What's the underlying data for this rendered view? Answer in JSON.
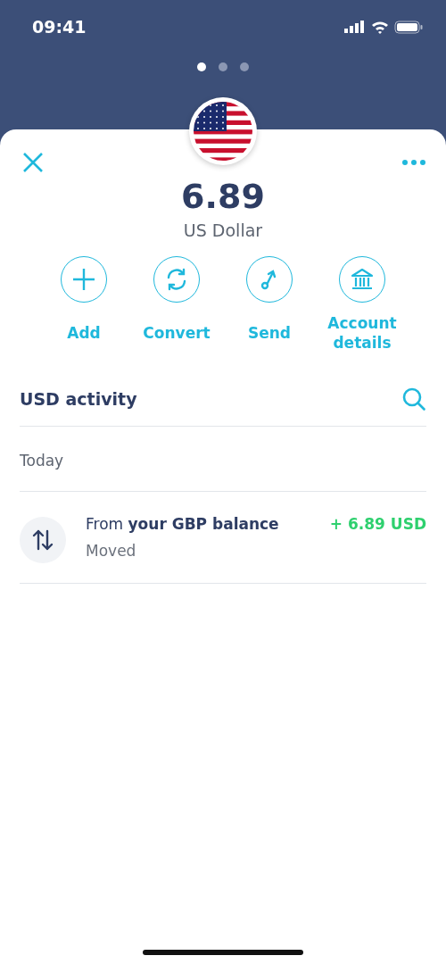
{
  "status_bar": {
    "time": "09:41"
  },
  "pager": [
    {
      "selected": true
    },
    {
      "selected": false
    },
    {
      "selected": false
    }
  ],
  "balance": {
    "amount": "6.89",
    "currency": "US Dollar"
  },
  "actions": [
    {
      "kind": "add",
      "label": "Add"
    },
    {
      "kind": "convert",
      "label": "Convert"
    },
    {
      "kind": "send",
      "label": "Send"
    },
    {
      "kind": "bank",
      "label": "Account details"
    }
  ],
  "activity": {
    "title": "USD activity",
    "groups": [
      {
        "label": "Today",
        "items": [
          {
            "title": "From **your GBP balance**",
            "subtitle": "Moved",
            "amount": "+ 6.89 USD"
          }
        ]
      }
    ]
  }
}
